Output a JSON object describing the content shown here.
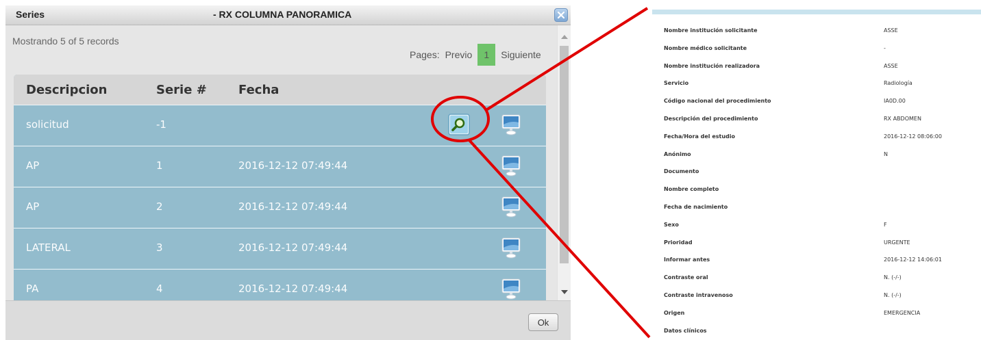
{
  "dialog": {
    "title": "Series",
    "subtitle": "- RX COLUMNA PANORAMICA",
    "records_text": "Mostrando 5 of 5 records",
    "pager": {
      "label": "Pages:",
      "prev": "Previo",
      "current": "1",
      "next": "Siguiente"
    },
    "columns": [
      "Descripcion",
      "Serie #",
      "Fecha"
    ],
    "rows": [
      {
        "descripcion": "solicitud",
        "serie": "-1",
        "fecha": "",
        "has_search": true
      },
      {
        "descripcion": "AP",
        "serie": "1",
        "fecha": "2016-12-12 07:49:44",
        "has_search": false
      },
      {
        "descripcion": "AP",
        "serie": "2",
        "fecha": "2016-12-12 07:49:44",
        "has_search": false
      },
      {
        "descripcion": "LATERAL",
        "serie": "3",
        "fecha": "2016-12-12 07:49:44",
        "has_search": false
      },
      {
        "descripcion": "PA",
        "serie": "4",
        "fecha": "2016-12-12 07:49:44",
        "has_search": false
      }
    ],
    "ok_label": "Ok",
    "icons": {
      "close": "close-icon",
      "search": "magnifier-icon",
      "view": "monitor-icon"
    }
  },
  "detail_panel": {
    "fields": [
      {
        "label": "Nombre institución solicitante",
        "value": "ASSE"
      },
      {
        "label": "Nombre médico solicitante",
        "value": "-"
      },
      {
        "label": "Nombre institución realizadora",
        "value": "ASSE"
      },
      {
        "label": "Servicio",
        "value": "Radiología"
      },
      {
        "label": "Código nacional del procedimiento",
        "value": "IA0D.00"
      },
      {
        "label": "Descripción del procedimiento",
        "value": "RX ABDOMEN"
      },
      {
        "label": "Fecha/Hora del estudio",
        "value": "2016-12-12 08:06:00"
      },
      {
        "label": "Anónimo",
        "value": "N"
      },
      {
        "label": "Documento",
        "value": ""
      },
      {
        "label": "Nombre completo",
        "value": ""
      },
      {
        "label": "Fecha de nacimiento",
        "value": ""
      },
      {
        "label": "Sexo",
        "value": "F"
      },
      {
        "label": "Prioridad",
        "value": "URGENTE"
      },
      {
        "label": "Informar antes",
        "value": "2016-12-12 14:06:01"
      },
      {
        "label": "Contraste oral",
        "value": "N. (-/-)"
      },
      {
        "label": "Contraste intravenoso",
        "value": "N. (-/-)"
      },
      {
        "label": "Origen",
        "value": "EMERGENCIA"
      },
      {
        "label": "Datos clínicos",
        "value": ""
      }
    ]
  },
  "colors": {
    "row_bg": "#93bccd",
    "header_bg": "#d6d6d6",
    "page_current": "#6fc36a",
    "annotation": "#e00000",
    "panel_accent": "#c9e3ee"
  }
}
